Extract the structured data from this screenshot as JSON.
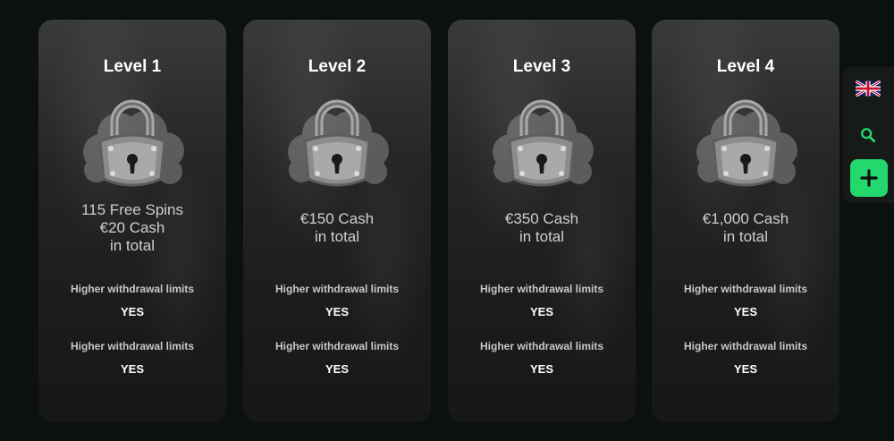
{
  "levels": [
    {
      "title": "Level 1",
      "reward_lines": [
        "115 Free Spins",
        "€20 Cash",
        "in total"
      ],
      "perks": [
        {
          "label": "Higher withdrawal limits",
          "value": "YES"
        },
        {
          "label": "Higher withdrawal limits",
          "value": "YES"
        }
      ]
    },
    {
      "title": "Level 2",
      "reward_lines": [
        "€150 Cash",
        "in total"
      ],
      "perks": [
        {
          "label": "Higher withdrawal limits",
          "value": "YES"
        },
        {
          "label": "Higher withdrawal limits",
          "value": "YES"
        }
      ]
    },
    {
      "title": "Level 3",
      "reward_lines": [
        "€350 Cash",
        "in total"
      ],
      "perks": [
        {
          "label": "Higher withdrawal limits",
          "value": "YES"
        },
        {
          "label": "Higher withdrawal limits",
          "value": "YES"
        }
      ]
    },
    {
      "title": "Level 4",
      "reward_lines": [
        "€1,000 Cash",
        "in total"
      ],
      "perks": [
        {
          "label": "Higher withdrawal limits",
          "value": "YES"
        },
        {
          "label": "Higher withdrawal limits",
          "value": "YES"
        }
      ]
    }
  ],
  "side_panel": {
    "language_icon": "uk-flag-icon",
    "search_icon": "search-icon",
    "add_icon": "plus-icon",
    "accent_color": "#23d96d"
  }
}
